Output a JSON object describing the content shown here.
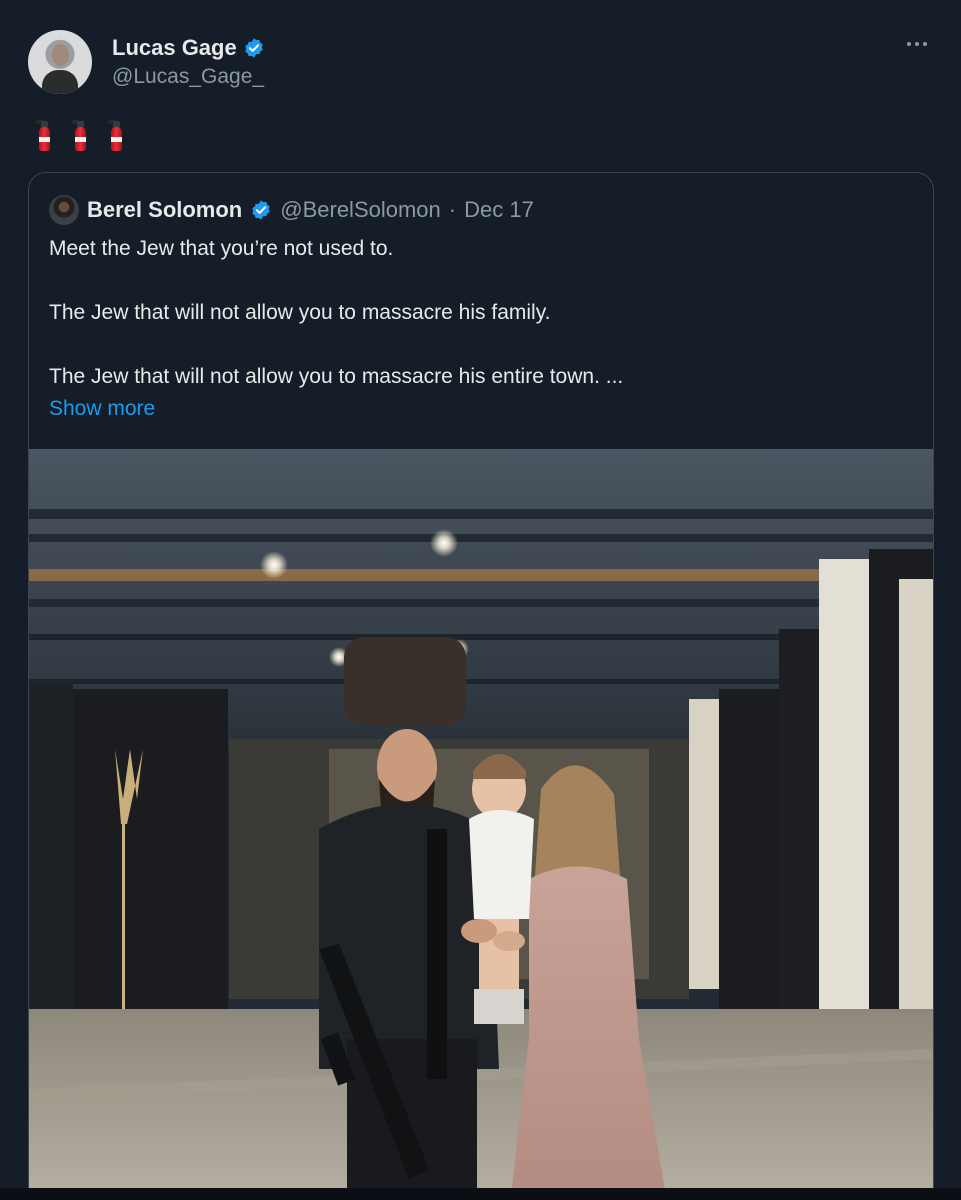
{
  "post": {
    "author": {
      "display_name": "Lucas Gage",
      "handle": "@Lucas_Gage_",
      "verified": true
    },
    "text_emojis": [
      "fire-extinguisher",
      "fire-extinguisher",
      "fire-extinguisher"
    ],
    "more_icon": "more-horizontal-icon"
  },
  "quote": {
    "author": {
      "display_name": "Berel Solomon",
      "handle": "@BerelSolomon",
      "separator": "·",
      "date": "Dec 17",
      "verified": true
    },
    "paragraphs": [
      "Meet the Jew that you’re not used to.",
      "The Jew that will not allow you to massacre his family.",
      "The Jew that will not allow you to massacre his entire town. ..."
    ],
    "show_more_label": "Show more"
  },
  "colors": {
    "background": "#151d28",
    "text": "#e7e9ea",
    "secondary_text": "#8b98a5",
    "link": "#1d9bf0",
    "verified_badge": "#1d9bf0",
    "border": "#3a4652"
  }
}
